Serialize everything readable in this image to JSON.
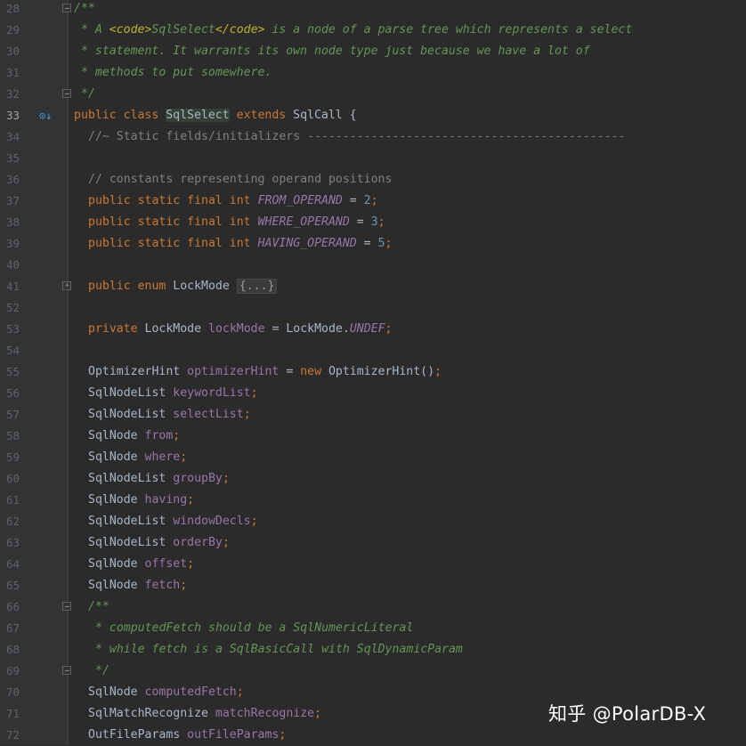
{
  "editor": {
    "lines": [
      {
        "n": "28",
        "fold": "open",
        "indent": 83,
        "tokens": [
          {
            "c": "doc",
            "t": "/**"
          }
        ]
      },
      {
        "n": "29",
        "indent": 91,
        "tokens": [
          {
            "c": "doc",
            "t": "* A "
          },
          {
            "c": "doctag",
            "t": "<code>"
          },
          {
            "c": "doc",
            "t": "SqlSelect"
          },
          {
            "c": "doctag",
            "t": "</code>"
          },
          {
            "c": "doc",
            "t": " is a node of a parse tree which represents a select"
          }
        ]
      },
      {
        "n": "30",
        "indent": 91,
        "tokens": [
          {
            "c": "doc",
            "t": "* statement. It warrants its own node type just because we have a lot of"
          }
        ]
      },
      {
        "n": "31",
        "indent": 91,
        "tokens": [
          {
            "c": "doc",
            "t": "* methods to put somewhere."
          }
        ]
      },
      {
        "n": "32",
        "fold": "open",
        "indent": 91,
        "tokens": [
          {
            "c": "doc",
            "t": "*/"
          }
        ]
      },
      {
        "n": "33",
        "current": true,
        "icon": "implementation-icon",
        "indent": 83,
        "tokens": [
          {
            "c": "kw",
            "t": "public class "
          },
          {
            "c": "cls hl",
            "t": "SqlSelect"
          },
          {
            "c": "kw",
            "t": " extends "
          },
          {
            "c": "cls",
            "t": "SqlCall {"
          }
        ]
      },
      {
        "n": "34",
        "indent": 99,
        "tokens": [
          {
            "c": "cmt",
            "t": "//~ Static fields/initializers ---------------------------------------------"
          }
        ]
      },
      {
        "n": "35",
        "indent": 99,
        "tokens": []
      },
      {
        "n": "36",
        "indent": 99,
        "tokens": [
          {
            "c": "cmt",
            "t": "// constants representing operand positions"
          }
        ]
      },
      {
        "n": "37",
        "indent": 99,
        "tokens": [
          {
            "c": "kw",
            "t": "public static final int "
          },
          {
            "c": "ifld",
            "t": "FROM_OPERAND"
          },
          {
            "c": "plain",
            "t": " = "
          },
          {
            "c": "num",
            "t": "2"
          },
          {
            "c": "kw",
            "t": ";"
          }
        ]
      },
      {
        "n": "38",
        "indent": 99,
        "tokens": [
          {
            "c": "kw",
            "t": "public static final int "
          },
          {
            "c": "ifld",
            "t": "WHERE_OPERAND"
          },
          {
            "c": "plain",
            "t": " = "
          },
          {
            "c": "num",
            "t": "3"
          },
          {
            "c": "kw",
            "t": ";"
          }
        ]
      },
      {
        "n": "39",
        "indent": 99,
        "tokens": [
          {
            "c": "kw",
            "t": "public static final int "
          },
          {
            "c": "ifld",
            "t": "HAVING_OPERAND"
          },
          {
            "c": "plain",
            "t": " = "
          },
          {
            "c": "num",
            "t": "5"
          },
          {
            "c": "kw",
            "t": ";"
          }
        ]
      },
      {
        "n": "40",
        "indent": 99,
        "tokens": []
      },
      {
        "n": "41",
        "fold": "closed",
        "indent": 99,
        "tokens": [
          {
            "c": "kw",
            "t": "public enum "
          },
          {
            "c": "cls",
            "t": "LockMode "
          },
          {
            "c": "foldtxt",
            "t": "{...}"
          }
        ]
      },
      {
        "n": "52",
        "indent": 99,
        "tokens": []
      },
      {
        "n": "53",
        "indent": 99,
        "tokens": [
          {
            "c": "kw",
            "t": "private "
          },
          {
            "c": "cls",
            "t": "LockMode "
          },
          {
            "c": "fld",
            "t": "lockMode"
          },
          {
            "c": "plain",
            "t": " = LockMode."
          },
          {
            "c": "ifld",
            "t": "UNDEF"
          },
          {
            "c": "kw",
            "t": ";"
          }
        ]
      },
      {
        "n": "54",
        "indent": 99,
        "tokens": []
      },
      {
        "n": "55",
        "indent": 99,
        "tokens": [
          {
            "c": "cls",
            "t": "OptimizerHint "
          },
          {
            "c": "fld",
            "t": "optimizerHint"
          },
          {
            "c": "plain",
            "t": " = "
          },
          {
            "c": "kw",
            "t": "new "
          },
          {
            "c": "cls",
            "t": "OptimizerHint()"
          },
          {
            "c": "kw",
            "t": ";"
          }
        ]
      },
      {
        "n": "56",
        "indent": 99,
        "tokens": [
          {
            "c": "cls",
            "t": "SqlNodeList "
          },
          {
            "c": "fld",
            "t": "keywordList"
          },
          {
            "c": "kw",
            "t": ";"
          }
        ]
      },
      {
        "n": "57",
        "indent": 99,
        "tokens": [
          {
            "c": "cls",
            "t": "SqlNodeList "
          },
          {
            "c": "fld",
            "t": "selectList"
          },
          {
            "c": "kw",
            "t": ";"
          }
        ]
      },
      {
        "n": "58",
        "indent": 99,
        "tokens": [
          {
            "c": "cls",
            "t": "SqlNode "
          },
          {
            "c": "fld",
            "t": "from"
          },
          {
            "c": "kw",
            "t": ";"
          }
        ]
      },
      {
        "n": "59",
        "indent": 99,
        "tokens": [
          {
            "c": "cls",
            "t": "SqlNode "
          },
          {
            "c": "fld",
            "t": "where"
          },
          {
            "c": "kw",
            "t": ";"
          }
        ]
      },
      {
        "n": "60",
        "indent": 99,
        "tokens": [
          {
            "c": "cls",
            "t": "SqlNodeList "
          },
          {
            "c": "fld",
            "t": "groupBy"
          },
          {
            "c": "kw",
            "t": ";"
          }
        ]
      },
      {
        "n": "61",
        "indent": 99,
        "tokens": [
          {
            "c": "cls",
            "t": "SqlNode "
          },
          {
            "c": "fld",
            "t": "having"
          },
          {
            "c": "kw",
            "t": ";"
          }
        ]
      },
      {
        "n": "62",
        "indent": 99,
        "tokens": [
          {
            "c": "cls",
            "t": "SqlNodeList "
          },
          {
            "c": "fld",
            "t": "windowDecls"
          },
          {
            "c": "kw",
            "t": ";"
          }
        ]
      },
      {
        "n": "63",
        "indent": 99,
        "tokens": [
          {
            "c": "cls",
            "t": "SqlNodeList "
          },
          {
            "c": "fld",
            "t": "orderBy"
          },
          {
            "c": "kw",
            "t": ";"
          }
        ]
      },
      {
        "n": "64",
        "indent": 99,
        "tokens": [
          {
            "c": "cls",
            "t": "SqlNode "
          },
          {
            "c": "fld",
            "t": "offset"
          },
          {
            "c": "kw",
            "t": ";"
          }
        ]
      },
      {
        "n": "65",
        "indent": 99,
        "tokens": [
          {
            "c": "cls",
            "t": "SqlNode "
          },
          {
            "c": "fld",
            "t": "fetch"
          },
          {
            "c": "kw",
            "t": ";"
          }
        ]
      },
      {
        "n": "66",
        "fold": "open",
        "indent": 99,
        "tokens": [
          {
            "c": "doc",
            "t": "/**"
          }
        ]
      },
      {
        "n": "67",
        "indent": 107,
        "tokens": [
          {
            "c": "doc",
            "t": "* computedFetch should be a SqlNumericLiteral"
          }
        ]
      },
      {
        "n": "68",
        "indent": 107,
        "tokens": [
          {
            "c": "doc",
            "t": "* while fetch is a SqlBasicCall with SqlDynamicParam"
          }
        ]
      },
      {
        "n": "69",
        "fold": "open",
        "indent": 107,
        "tokens": [
          {
            "c": "doc",
            "t": "*/"
          }
        ]
      },
      {
        "n": "70",
        "indent": 99,
        "tokens": [
          {
            "c": "cls",
            "t": "SqlNode "
          },
          {
            "c": "fld",
            "t": "computedFetch"
          },
          {
            "c": "kw",
            "t": ";"
          }
        ]
      },
      {
        "n": "71",
        "indent": 99,
        "tokens": [
          {
            "c": "cls",
            "t": "SqlMatchRecognize "
          },
          {
            "c": "fld",
            "t": "matchRecognize"
          },
          {
            "c": "kw",
            "t": ";"
          }
        ]
      },
      {
        "n": "72",
        "indent": 99,
        "tokens": [
          {
            "c": "cls",
            "t": "OutFileParams "
          },
          {
            "c": "fld",
            "t": "outFileParams"
          },
          {
            "c": "kw",
            "t": ";"
          }
        ]
      }
    ]
  },
  "watermark": {
    "text": "知乎 @PolarDB-X"
  }
}
